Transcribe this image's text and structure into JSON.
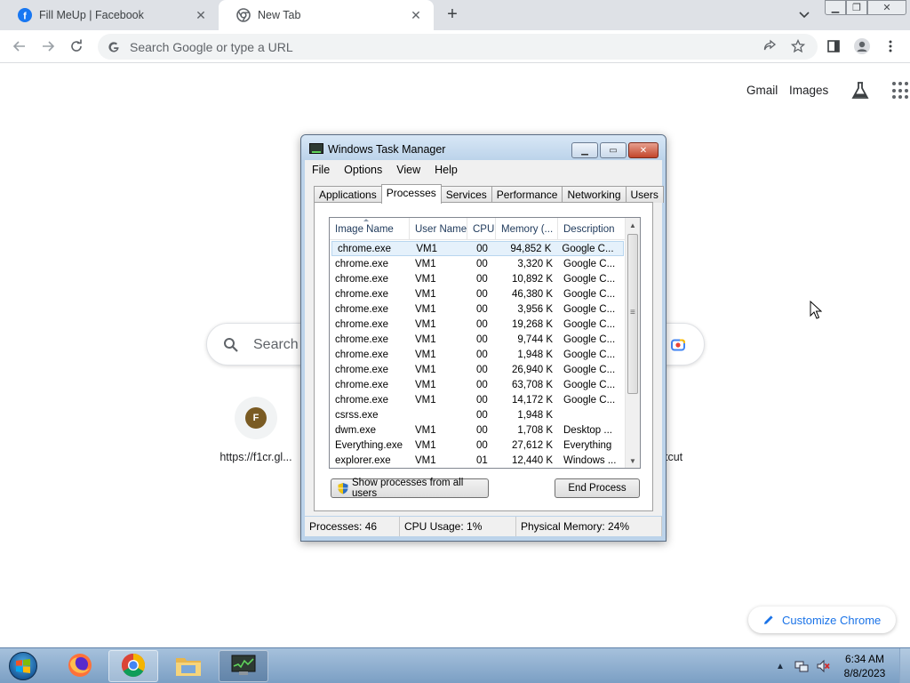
{
  "browser": {
    "tabs": [
      {
        "title": "Fill MeUp | Facebook",
        "favicon": "facebook-icon",
        "active": false
      },
      {
        "title": "New Tab",
        "favicon": "chrome-icon",
        "active": true
      }
    ],
    "omnibox": {
      "placeholder": "Search Google or type a URL",
      "value": ""
    }
  },
  "ntp": {
    "links": {
      "gmail": "Gmail",
      "images": "Images"
    },
    "search_placeholder": "Search Google or type a URL",
    "search_visible_text": "Search",
    "shortcuts": [
      {
        "letter": "F",
        "label": "https://f1cr.gl..."
      }
    ],
    "add_shortcut_label": "Add shortcut",
    "add_shortcut_visible": "tcut",
    "customize_label": "Customize Chrome"
  },
  "task_manager": {
    "title": "Windows Task Manager",
    "menu": [
      "File",
      "Options",
      "View",
      "Help"
    ],
    "tabs": [
      "Applications",
      "Processes",
      "Services",
      "Performance",
      "Networking",
      "Users"
    ],
    "active_tab": "Processes",
    "columns": {
      "name": "Image Name",
      "user": "User Name",
      "cpu": "CPU",
      "memory": "Memory (...",
      "description": "Description"
    },
    "rows": [
      {
        "name": "chrome.exe",
        "user": "VM1",
        "cpu": "00",
        "memory": "94,852 K",
        "description": "Google C...",
        "selected": true
      },
      {
        "name": "chrome.exe",
        "user": "VM1",
        "cpu": "00",
        "memory": "3,320 K",
        "description": "Google C..."
      },
      {
        "name": "chrome.exe",
        "user": "VM1",
        "cpu": "00",
        "memory": "10,892 K",
        "description": "Google C..."
      },
      {
        "name": "chrome.exe",
        "user": "VM1",
        "cpu": "00",
        "memory": "46,380 K",
        "description": "Google C..."
      },
      {
        "name": "chrome.exe",
        "user": "VM1",
        "cpu": "00",
        "memory": "3,956 K",
        "description": "Google C..."
      },
      {
        "name": "chrome.exe",
        "user": "VM1",
        "cpu": "00",
        "memory": "19,268 K",
        "description": "Google C..."
      },
      {
        "name": "chrome.exe",
        "user": "VM1",
        "cpu": "00",
        "memory": "9,744 K",
        "description": "Google C..."
      },
      {
        "name": "chrome.exe",
        "user": "VM1",
        "cpu": "00",
        "memory": "1,948 K",
        "description": "Google C..."
      },
      {
        "name": "chrome.exe",
        "user": "VM1",
        "cpu": "00",
        "memory": "26,940 K",
        "description": "Google C..."
      },
      {
        "name": "chrome.exe",
        "user": "VM1",
        "cpu": "00",
        "memory": "63,708 K",
        "description": "Google C..."
      },
      {
        "name": "chrome.exe",
        "user": "VM1",
        "cpu": "00",
        "memory": "14,172 K",
        "description": "Google C..."
      },
      {
        "name": "csrss.exe",
        "user": "",
        "cpu": "00",
        "memory": "1,948 K",
        "description": ""
      },
      {
        "name": "dwm.exe",
        "user": "VM1",
        "cpu": "00",
        "memory": "1,708 K",
        "description": "Desktop ..."
      },
      {
        "name": "Everything.exe",
        "user": "VM1",
        "cpu": "00",
        "memory": "27,612 K",
        "description": "Everything"
      },
      {
        "name": "explorer.exe",
        "user": "VM1",
        "cpu": "01",
        "memory": "12,440 K",
        "description": "Windows ..."
      }
    ],
    "show_all_label": "Show processes from all users",
    "end_process_label": "End Process",
    "status": {
      "processes": "Processes: 46",
      "cpu": "CPU Usage: 1%",
      "memory": "Physical Memory: 24%"
    }
  },
  "taskbar": {
    "items": [
      "firefox-icon",
      "chrome-icon",
      "file-explorer-icon",
      "task-manager-icon"
    ],
    "clock": {
      "time": "6:34 AM",
      "date": "8/8/2023"
    }
  },
  "colors": {
    "link_blue": "#1a73e8",
    "tab_strip": "#dee1e6",
    "taskbar": "#a6c1dc"
  }
}
